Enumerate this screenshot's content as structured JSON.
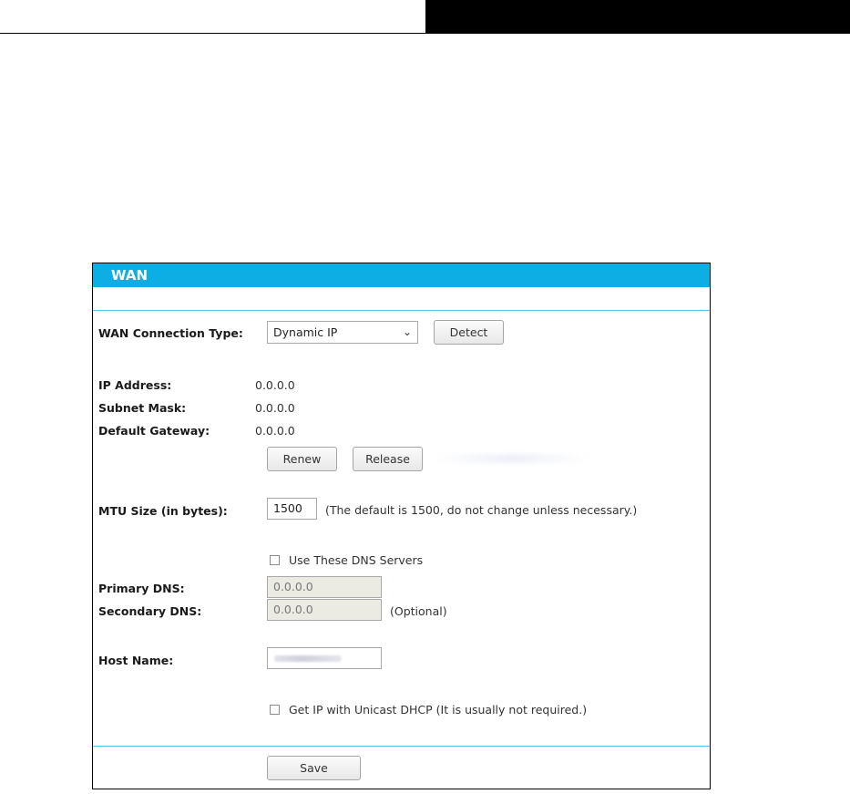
{
  "panel": {
    "title": "WAN"
  },
  "connection": {
    "label": "WAN Connection Type:",
    "selected": "Dynamic IP",
    "detect_label": "Detect"
  },
  "status": {
    "ip_label": "IP Address:",
    "ip_value": "0.0.0.0",
    "mask_label": "Subnet Mask:",
    "mask_value": "0.0.0.0",
    "gateway_label": "Default Gateway:",
    "gateway_value": "0.0.0.0",
    "renew_label": "Renew",
    "release_label": "Release"
  },
  "mtu": {
    "label": "MTU Size (in bytes):",
    "value": "1500",
    "note": "(The default is 1500, do not change unless necessary.)"
  },
  "dns": {
    "use_label": "Use These DNS Servers",
    "use_checked": false,
    "primary_label": "Primary DNS:",
    "primary_value": "0.0.0.0",
    "secondary_label": "Secondary DNS:",
    "secondary_value": "0.0.0.0",
    "optional_note": "(Optional)"
  },
  "host": {
    "label": "Host Name:"
  },
  "unicast": {
    "label": "Get IP with Unicast DHCP (It is usually not required.)",
    "checked": false
  },
  "save_label": "Save",
  "colors": {
    "header": "#0daee3",
    "divider": "#56c3ea"
  },
  "icons": {
    "select_chevron": "chevron-down-icon"
  }
}
